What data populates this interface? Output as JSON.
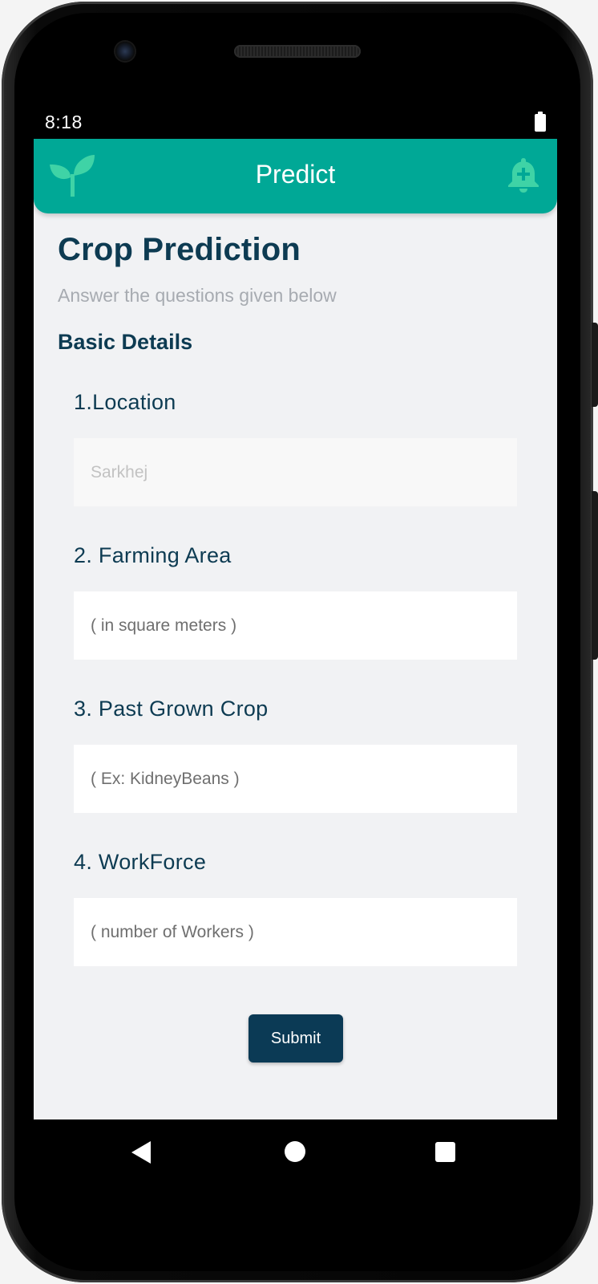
{
  "status_bar": {
    "time": "8:18",
    "battery_icon": "battery-full-icon"
  },
  "app_bar": {
    "title": "Predict",
    "logo_icon": "sprout-icon",
    "action_icon": "notification-add-icon",
    "color": "#00a896"
  },
  "page": {
    "title": "Crop Prediction",
    "subtitle": "Answer the questions given below",
    "section_title": "Basic Details"
  },
  "questions": [
    {
      "label": "1.Location",
      "placeholder": "Sarkhej",
      "value": ""
    },
    {
      "label": "2. Farming Area",
      "placeholder": "( in square meters )",
      "value": ""
    },
    {
      "label": "3. Past Grown Crop",
      "placeholder": "( Ex: KidneyBeans )",
      "value": ""
    },
    {
      "label": "4. WorkForce",
      "placeholder": "( number of Workers )",
      "value": ""
    }
  ],
  "submit_label": "Submit",
  "colors": {
    "accent": "#00a896",
    "primary_dark": "#0b3a55",
    "background": "#f1f2f4"
  },
  "nav_bar": {
    "back_icon": "back-triangle-icon",
    "home_icon": "home-circle-icon",
    "recents_icon": "recents-square-icon"
  }
}
